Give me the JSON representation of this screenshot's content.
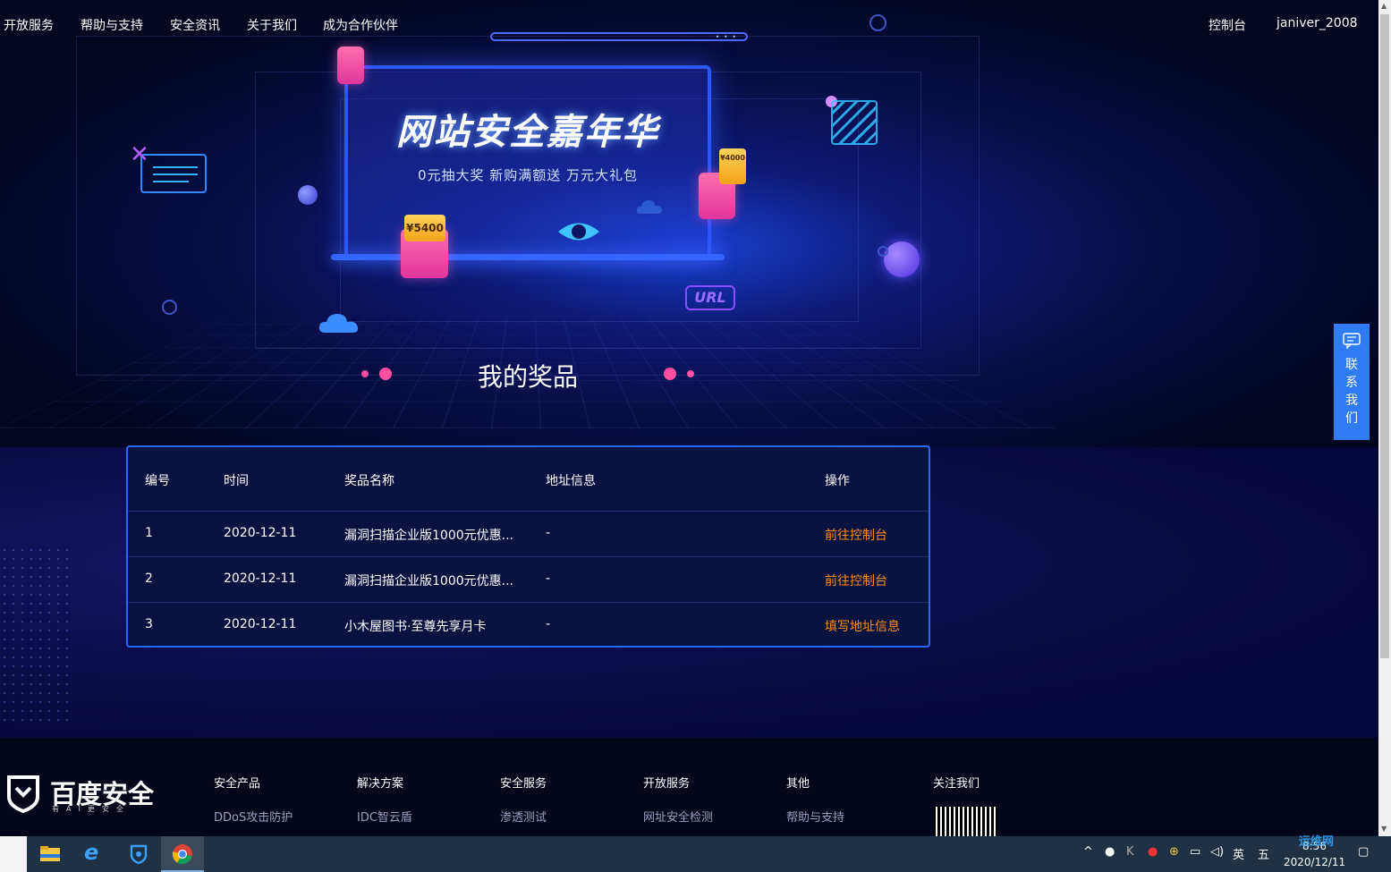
{
  "nav": {
    "left": [
      "开放服务",
      "帮助与支持",
      "安全资讯",
      "关于我们",
      "成为合作伙伴"
    ],
    "console": "控制台",
    "user": "janiver_2008"
  },
  "banner": {
    "title": "网站安全嘉年华",
    "subtitle": "0元抽大奖  新购满额送  万元大礼包",
    "coupon_big": "¥5400",
    "coupon_small": "¥4000",
    "url_tag": "URL"
  },
  "section_title": "我的奖品",
  "contact": {
    "label": "联系我们"
  },
  "table": {
    "headers": [
      "编号",
      "时间",
      "奖品名称",
      "地址信息",
      "操作"
    ],
    "rows": [
      {
        "no": "1",
        "time": "2020-12-11",
        "prize": "漏洞扫描企业版1000元优惠...",
        "address": "-",
        "action": "前往控制台"
      },
      {
        "no": "2",
        "time": "2020-12-11",
        "prize": "漏洞扫描企业版1000元优惠...",
        "address": "-",
        "action": "前往控制台"
      },
      {
        "no": "3",
        "time": "2020-12-11",
        "prize": "小木屋图书·至尊先享月卡",
        "address": "-",
        "action": "填写地址信息"
      }
    ]
  },
  "footer": {
    "brand": "百度安全",
    "slogan": "有AI更安全",
    "columns": [
      {
        "title": "安全产品",
        "item": "DDoS攻击防护"
      },
      {
        "title": "解决方案",
        "item": "IDC智云盾"
      },
      {
        "title": "安全服务",
        "item": "渗透测试"
      },
      {
        "title": "开放服务",
        "item": "网址安全检测"
      },
      {
        "title": "其他",
        "item": "帮助与支持"
      }
    ],
    "follow": "关注我们"
  },
  "taskbar": {
    "ime_lang": "英",
    "ime_mode": "五",
    "time": "8:56",
    "date": "2020/12/11",
    "watermark": "运维网"
  },
  "colors": {
    "accent_blue": "#2f7cf6",
    "link_orange": "#ff8d1a",
    "table_border": "#2a67ff"
  }
}
